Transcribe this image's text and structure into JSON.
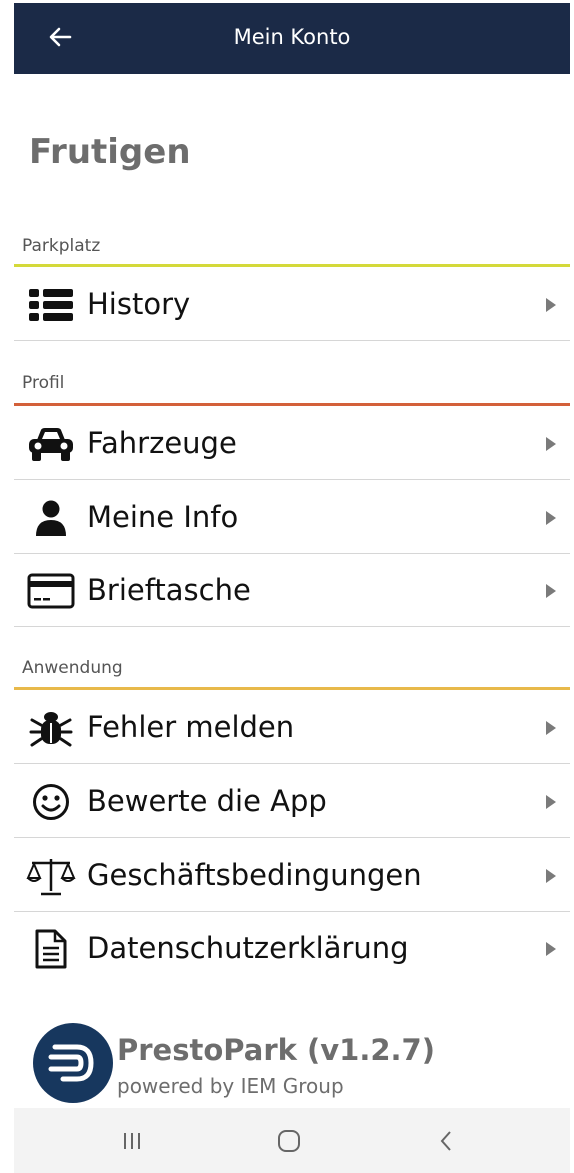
{
  "appbar": {
    "title": "Mein Konto",
    "back_icon": "arrow-left-icon"
  },
  "location": {
    "name": "Frutigen"
  },
  "sections": [
    {
      "title": "Parkplatz",
      "color": "#d4d93a"
    },
    {
      "title": "Profil",
      "color": "#d3603a"
    },
    {
      "title": "Anwendung",
      "color": "#e8b94a"
    }
  ],
  "items": [
    {
      "label": "History",
      "icon": "list-icon"
    },
    {
      "label": "Fahrzeuge",
      "icon": "car-icon"
    },
    {
      "label": "Meine Info",
      "icon": "user-icon"
    },
    {
      "label": "Brieftasche",
      "icon": "credit-card-icon"
    },
    {
      "label": "Fehler melden",
      "icon": "bug-icon"
    },
    {
      "label": "Bewerte die App",
      "icon": "smiley-icon"
    },
    {
      "label": "Geschäftsbedingungen",
      "icon": "scale-icon"
    },
    {
      "label": "Datenschutzerklärung",
      "icon": "document-icon"
    }
  ],
  "footer": {
    "brand": "PrestoPark (v1.2.7)",
    "powered": "powered by IEM Group",
    "logo_color": "#17375e"
  },
  "system_nav": {
    "recents_icon": "recents-icon",
    "home_icon": "home-icon",
    "back_icon": "back-chevron-icon"
  },
  "colors": {
    "appbar_bg": "#1b2a47",
    "chevron": "#7a7a7a"
  }
}
